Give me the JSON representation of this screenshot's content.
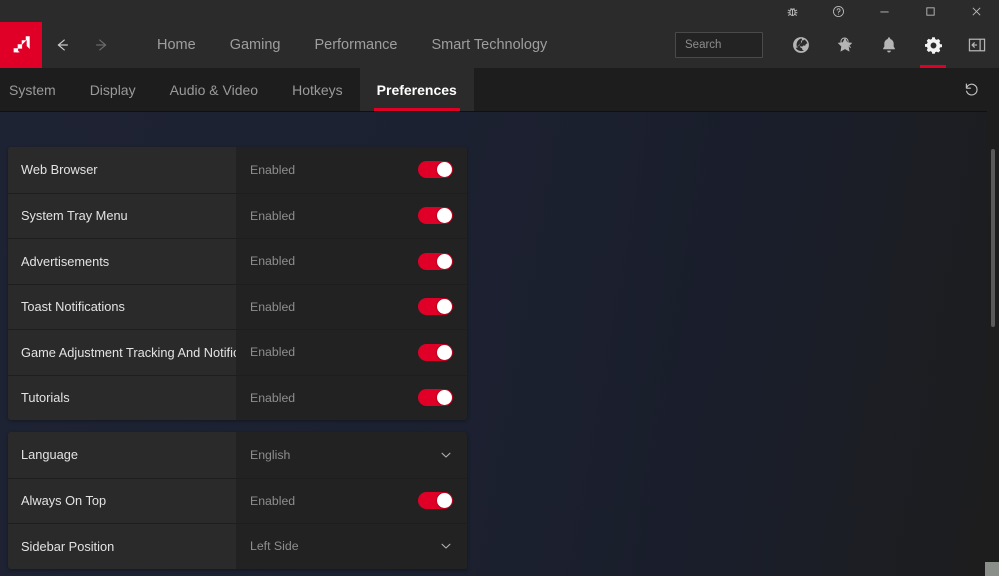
{
  "titlebar": {
    "buttons": [
      {
        "name": "bug-report-icon",
        "label": "Report a Bug"
      },
      {
        "name": "help-icon",
        "label": "Help"
      },
      {
        "name": "minimize-icon",
        "label": "Minimize"
      },
      {
        "name": "maximize-icon",
        "label": "Maximize"
      },
      {
        "name": "close-icon",
        "label": "Close"
      }
    ]
  },
  "nav": {
    "logo_alt": "AMD",
    "back_label": "Back",
    "forward_label": "Forward",
    "links": [
      {
        "label": "Home"
      },
      {
        "label": "Gaming"
      },
      {
        "label": "Performance"
      },
      {
        "label": "Smart Technology"
      }
    ],
    "search": {
      "placeholder": "Search",
      "value": ""
    },
    "icons": [
      {
        "name": "globe-icon",
        "label": "Streaming",
        "active": false
      },
      {
        "name": "star-icon",
        "label": "Favorites",
        "active": false
      },
      {
        "name": "bell-icon",
        "label": "Notifications",
        "active": false
      },
      {
        "name": "gear-icon",
        "label": "Settings",
        "active": true
      },
      {
        "name": "sidebar-toggle-icon",
        "label": "Toggle Sidebar",
        "active": false
      }
    ]
  },
  "tabs": {
    "items": [
      {
        "label": "System",
        "active": false
      },
      {
        "label": "Display",
        "active": false
      },
      {
        "label": "Audio & Video",
        "active": false
      },
      {
        "label": "Hotkeys",
        "active": false
      },
      {
        "label": "Preferences",
        "active": true
      }
    ],
    "reset_label": "Reset"
  },
  "preferences": {
    "groups": [
      {
        "rows": [
          {
            "label": "Web Browser",
            "value": "Enabled",
            "control": "toggle",
            "state": "on"
          },
          {
            "label": "System Tray Menu",
            "value": "Enabled",
            "control": "toggle",
            "state": "on"
          },
          {
            "label": "Advertisements",
            "value": "Enabled",
            "control": "toggle",
            "state": "on"
          },
          {
            "label": "Toast Notifications",
            "value": "Enabled",
            "control": "toggle",
            "state": "on"
          },
          {
            "label": "Game Adjustment Tracking And Notifica...",
            "value": "Enabled",
            "control": "toggle",
            "state": "on"
          },
          {
            "label": "Tutorials",
            "value": "Enabled",
            "control": "toggle",
            "state": "on"
          }
        ]
      },
      {
        "rows": [
          {
            "label": "Language",
            "value": "English",
            "control": "dropdown",
            "state": ""
          },
          {
            "label": "Always On Top",
            "value": "Enabled",
            "control": "toggle",
            "state": "on"
          },
          {
            "label": "Sidebar Position",
            "value": "Left Side",
            "control": "dropdown",
            "state": ""
          }
        ]
      }
    ]
  },
  "colors": {
    "accent": "#e00027",
    "titlebar_bg": "#2b2b2b",
    "tabbar_bg": "#1d1d1d",
    "content_bg": "#1c2131",
    "row_label_bg": "#2a2a2a",
    "row_value_bg": "#222222"
  }
}
